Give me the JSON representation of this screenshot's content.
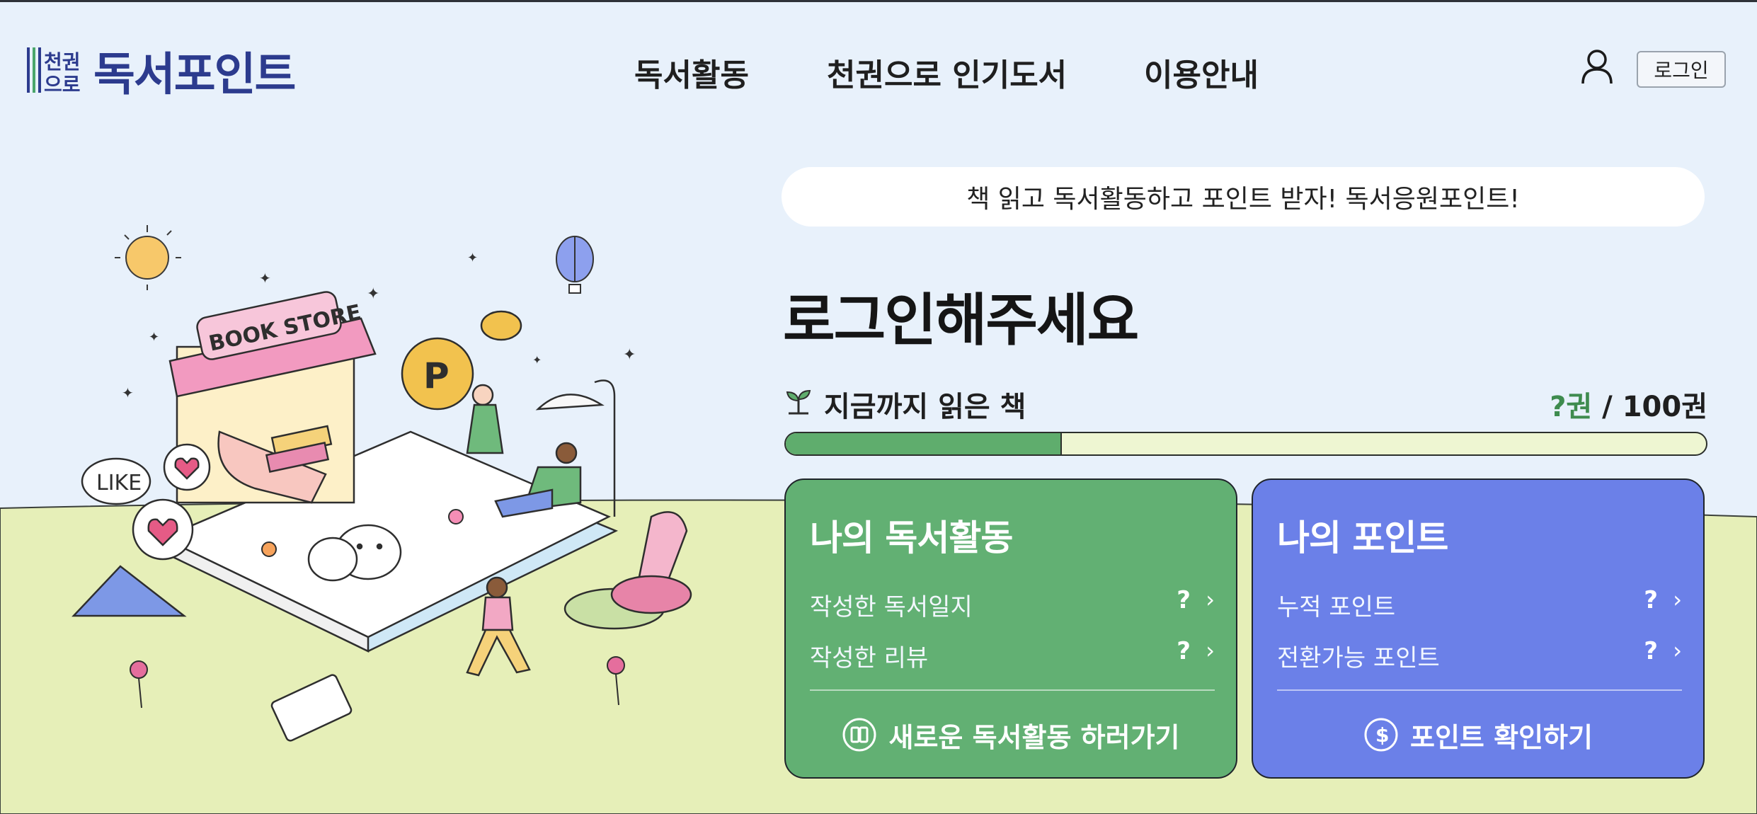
{
  "header": {
    "logo_mark_top": "천권",
    "logo_mark_bottom": "으로",
    "logo_text": "독서포인트",
    "nav": [
      "독서활동",
      "천권으로 인기도서",
      "이용안내"
    ],
    "login_label": "로그인"
  },
  "banner": {
    "text": "책 읽고 독서활동하고 포인트 받자! 독서응원포인트!"
  },
  "main": {
    "title": "로그인해주세요",
    "read_label": "지금까지 읽은 책",
    "read_current": "?권",
    "read_sep": " / ",
    "read_total": "100권",
    "progress_fraction": 0.3
  },
  "cards": {
    "activity": {
      "title": "나의 독서활동",
      "rows": [
        {
          "label": "작성한 독서일지",
          "value": "?"
        },
        {
          "label": "작성한 리뷰",
          "value": "?"
        }
      ],
      "cta": "새로운 독서활동 하러가기"
    },
    "points": {
      "title": "나의 포인트",
      "rows": [
        {
          "label": "누적 포인트",
          "value": "?"
        },
        {
          "label": "전환가능 포인트",
          "value": "?"
        }
      ],
      "cta": "포인트 확인하기"
    }
  },
  "illustration": {
    "store_sign": "BOOK STORE",
    "like_bubble": "LIKE",
    "coin_letter": "P"
  },
  "colors": {
    "background": "#e8f1fb",
    "ground": "#e6efb8",
    "green_card": "#62b073",
    "blue_card": "#6b80e8",
    "progress_fill": "#5fad6d",
    "logo": "#2c3b8e"
  }
}
